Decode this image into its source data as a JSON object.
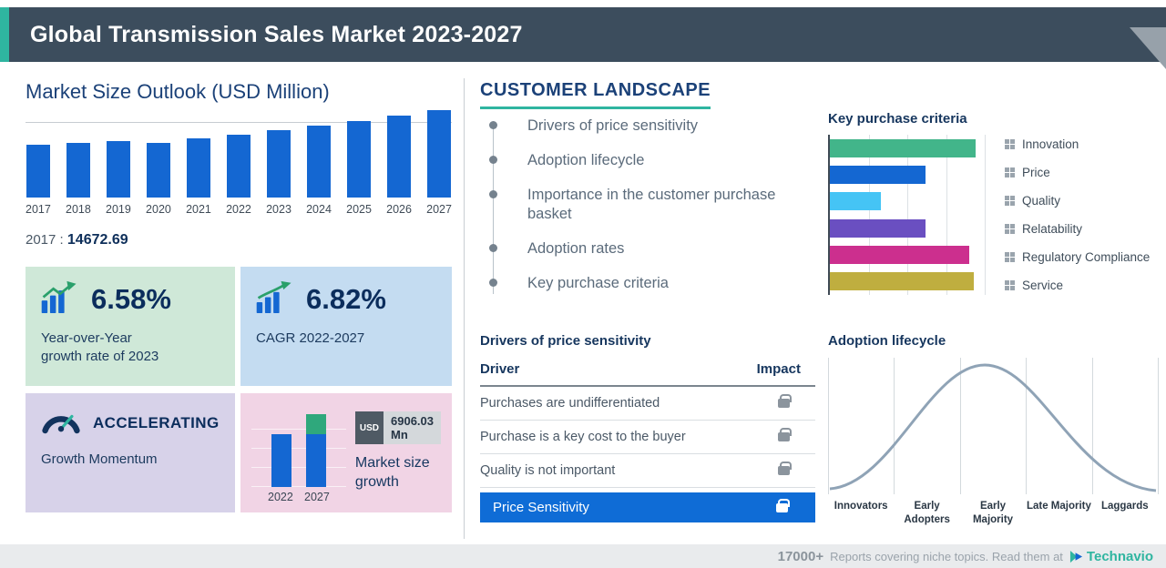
{
  "header": {
    "title": "Global Transmission Sales Market 2023-2027",
    "bg_color": "#3c4d5d",
    "accent_color": "#2fb5a0"
  },
  "market_size": {
    "title": "Market Size Outlook (USD Million)",
    "base_year_label": "2017",
    "base_year_sep": " : ",
    "base_year_value": "14672.69"
  },
  "cards": {
    "yoy": {
      "value": "6.58%",
      "caption_line1": "Year-over-Year",
      "caption_line2": "growth rate of 2023"
    },
    "cagr": {
      "value": "6.82%",
      "caption": "CAGR 2022-2027"
    },
    "momentum": {
      "title": "ACCELERATING",
      "caption": "Growth Momentum"
    },
    "size_growth": {
      "badge_currency": "USD",
      "badge_value": "6906.03 Mn",
      "caption_line1": "Market size",
      "caption_line2": "growth",
      "year_start": "2022",
      "year_end": "2027"
    }
  },
  "customer_landscape": {
    "title": "CUSTOMER LANDSCAPE",
    "items": [
      "Drivers of price sensitivity",
      "Adoption lifecycle",
      "Importance in the customer purchase basket",
      "Adoption rates",
      "Key purchase criteria"
    ]
  },
  "price_sensitivity": {
    "title": "Drivers of price sensitivity",
    "columns": {
      "driver": "Driver",
      "impact": "Impact"
    },
    "rows": [
      "Purchases are undifferentiated",
      "Purchase is a key cost to the buyer",
      "Quality is not important"
    ],
    "highlight_row": "Price Sensitivity",
    "highlight_color": "#0f6cd6"
  },
  "footer": {
    "count": "17000+",
    "text": "Reports covering niche topics. Read them at",
    "brand": "Technavio",
    "brand_color": "#2fb5a0"
  },
  "chart_data": [
    {
      "type": "bar",
      "title": "Market Size Outlook (USD Million)",
      "categories": [
        "2017",
        "2018",
        "2019",
        "2020",
        "2021",
        "2022",
        "2023",
        "2024",
        "2025",
        "2026",
        "2027"
      ],
      "values": [
        14672.69,
        15300,
        15900,
        15350,
        16600,
        17670,
        18870,
        20160,
        21530,
        23000,
        24570
      ],
      "ylim": [
        0,
        25000
      ],
      "bar_color": "#1467d2",
      "labeled_point": {
        "year": "2017",
        "value": 14672.69
      },
      "note": "only 2017 value labeled on screen; later years estimated from bar heights, YoY 6.58% and CAGR 6.82%"
    },
    {
      "type": "bar",
      "orientation": "horizontal",
      "title": "Key purchase criteria",
      "categories": [
        "Innovation",
        "Price",
        "Quality",
        "Relatability",
        "Regulatory Compliance",
        "Service"
      ],
      "values": [
        94,
        62,
        33,
        62,
        90,
        93
      ],
      "xlim": [
        0,
        100
      ],
      "colors": [
        "#42b58a",
        "#1467d2",
        "#45c4f5",
        "#6a4fc1",
        "#cc2f8e",
        "#bfae3f"
      ],
      "legend_position": "right"
    },
    {
      "type": "area",
      "title": "Adoption lifecycle",
      "curve": "bell",
      "categories": [
        "Innovators",
        "Early Adopters",
        "Early Majority",
        "Late Majority",
        "Laggards"
      ]
    },
    {
      "type": "bar",
      "title": "Market size growth",
      "categories": [
        "2022",
        "2027"
      ],
      "values": [
        17670,
        24573
      ],
      "growth_usd_mn": 6906.03,
      "colors": [
        "#1467d2",
        "#2fa87c"
      ]
    }
  ]
}
